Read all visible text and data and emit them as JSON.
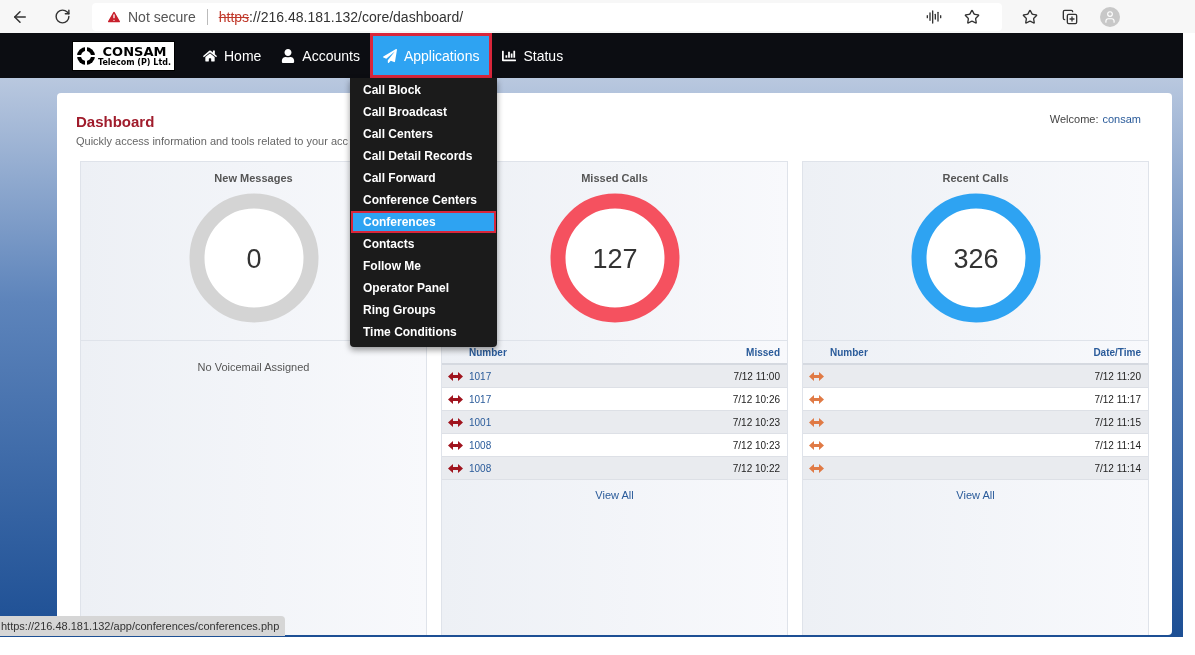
{
  "browser": {
    "security": "Not secure",
    "scheme": "https",
    "url": "://216.48.181.132/core/dashboard/"
  },
  "nav": {
    "logo": {
      "name": "CONSAM",
      "tagline": "Telecom (P) Ltd."
    },
    "items": [
      {
        "label": "Home",
        "selected": false
      },
      {
        "label": "Accounts",
        "selected": false
      },
      {
        "label": "Applications",
        "selected": true
      },
      {
        "label": "Status",
        "selected": false
      }
    ]
  },
  "menu": {
    "items": [
      {
        "label": "Call Block",
        "selected": false
      },
      {
        "label": "Call Broadcast",
        "selected": false
      },
      {
        "label": "Call Centers",
        "selected": false
      },
      {
        "label": "Call Detail Records",
        "selected": false
      },
      {
        "label": "Call Forward",
        "selected": false
      },
      {
        "label": "Conference Centers",
        "selected": false
      },
      {
        "label": "Conferences",
        "selected": true
      },
      {
        "label": "Contacts",
        "selected": false
      },
      {
        "label": "Follow Me",
        "selected": false
      },
      {
        "label": "Operator Panel",
        "selected": false
      },
      {
        "label": "Ring Groups",
        "selected": false
      },
      {
        "label": "Time Conditions",
        "selected": false
      }
    ]
  },
  "dashboard": {
    "title": "Dashboard",
    "subtitle": "Quickly access information and tools related to your acc",
    "welcome_label": "Welcome:",
    "user": "consam"
  },
  "panels": [
    {
      "kind": "voicemail",
      "title": "New Messages",
      "count": "0",
      "color": "#d4d4d4",
      "message": "No Voicemail Assigned"
    },
    {
      "kind": "missed",
      "title": "Missed Calls",
      "count": "127",
      "color": "#f5515f",
      "columns": [
        "Number",
        "Missed"
      ],
      "rows": [
        {
          "number": "1017",
          "time": "7/12 11:00"
        },
        {
          "number": "1017",
          "time": "7/12 10:26"
        },
        {
          "number": "1001",
          "time": "7/12 10:23"
        },
        {
          "number": "1008",
          "time": "7/12 10:23"
        },
        {
          "number": "1008",
          "time": "7/12 10:22"
        }
      ],
      "footer": "View All"
    },
    {
      "kind": "recent",
      "title": "Recent Calls",
      "count": "326",
      "color": "#2ea3f2",
      "columns": [
        "Number",
        "Date/Time"
      ],
      "rows": [
        {
          "time": "7/12 11:20"
        },
        {
          "time": "7/12 11:17"
        },
        {
          "time": "7/12 11:15"
        },
        {
          "time": "7/12 11:14"
        },
        {
          "time": "7/12 11:14"
        }
      ],
      "footer": "View All"
    }
  ],
  "status_url": "https://216.48.181.132/app/conferences/conferences.php"
}
